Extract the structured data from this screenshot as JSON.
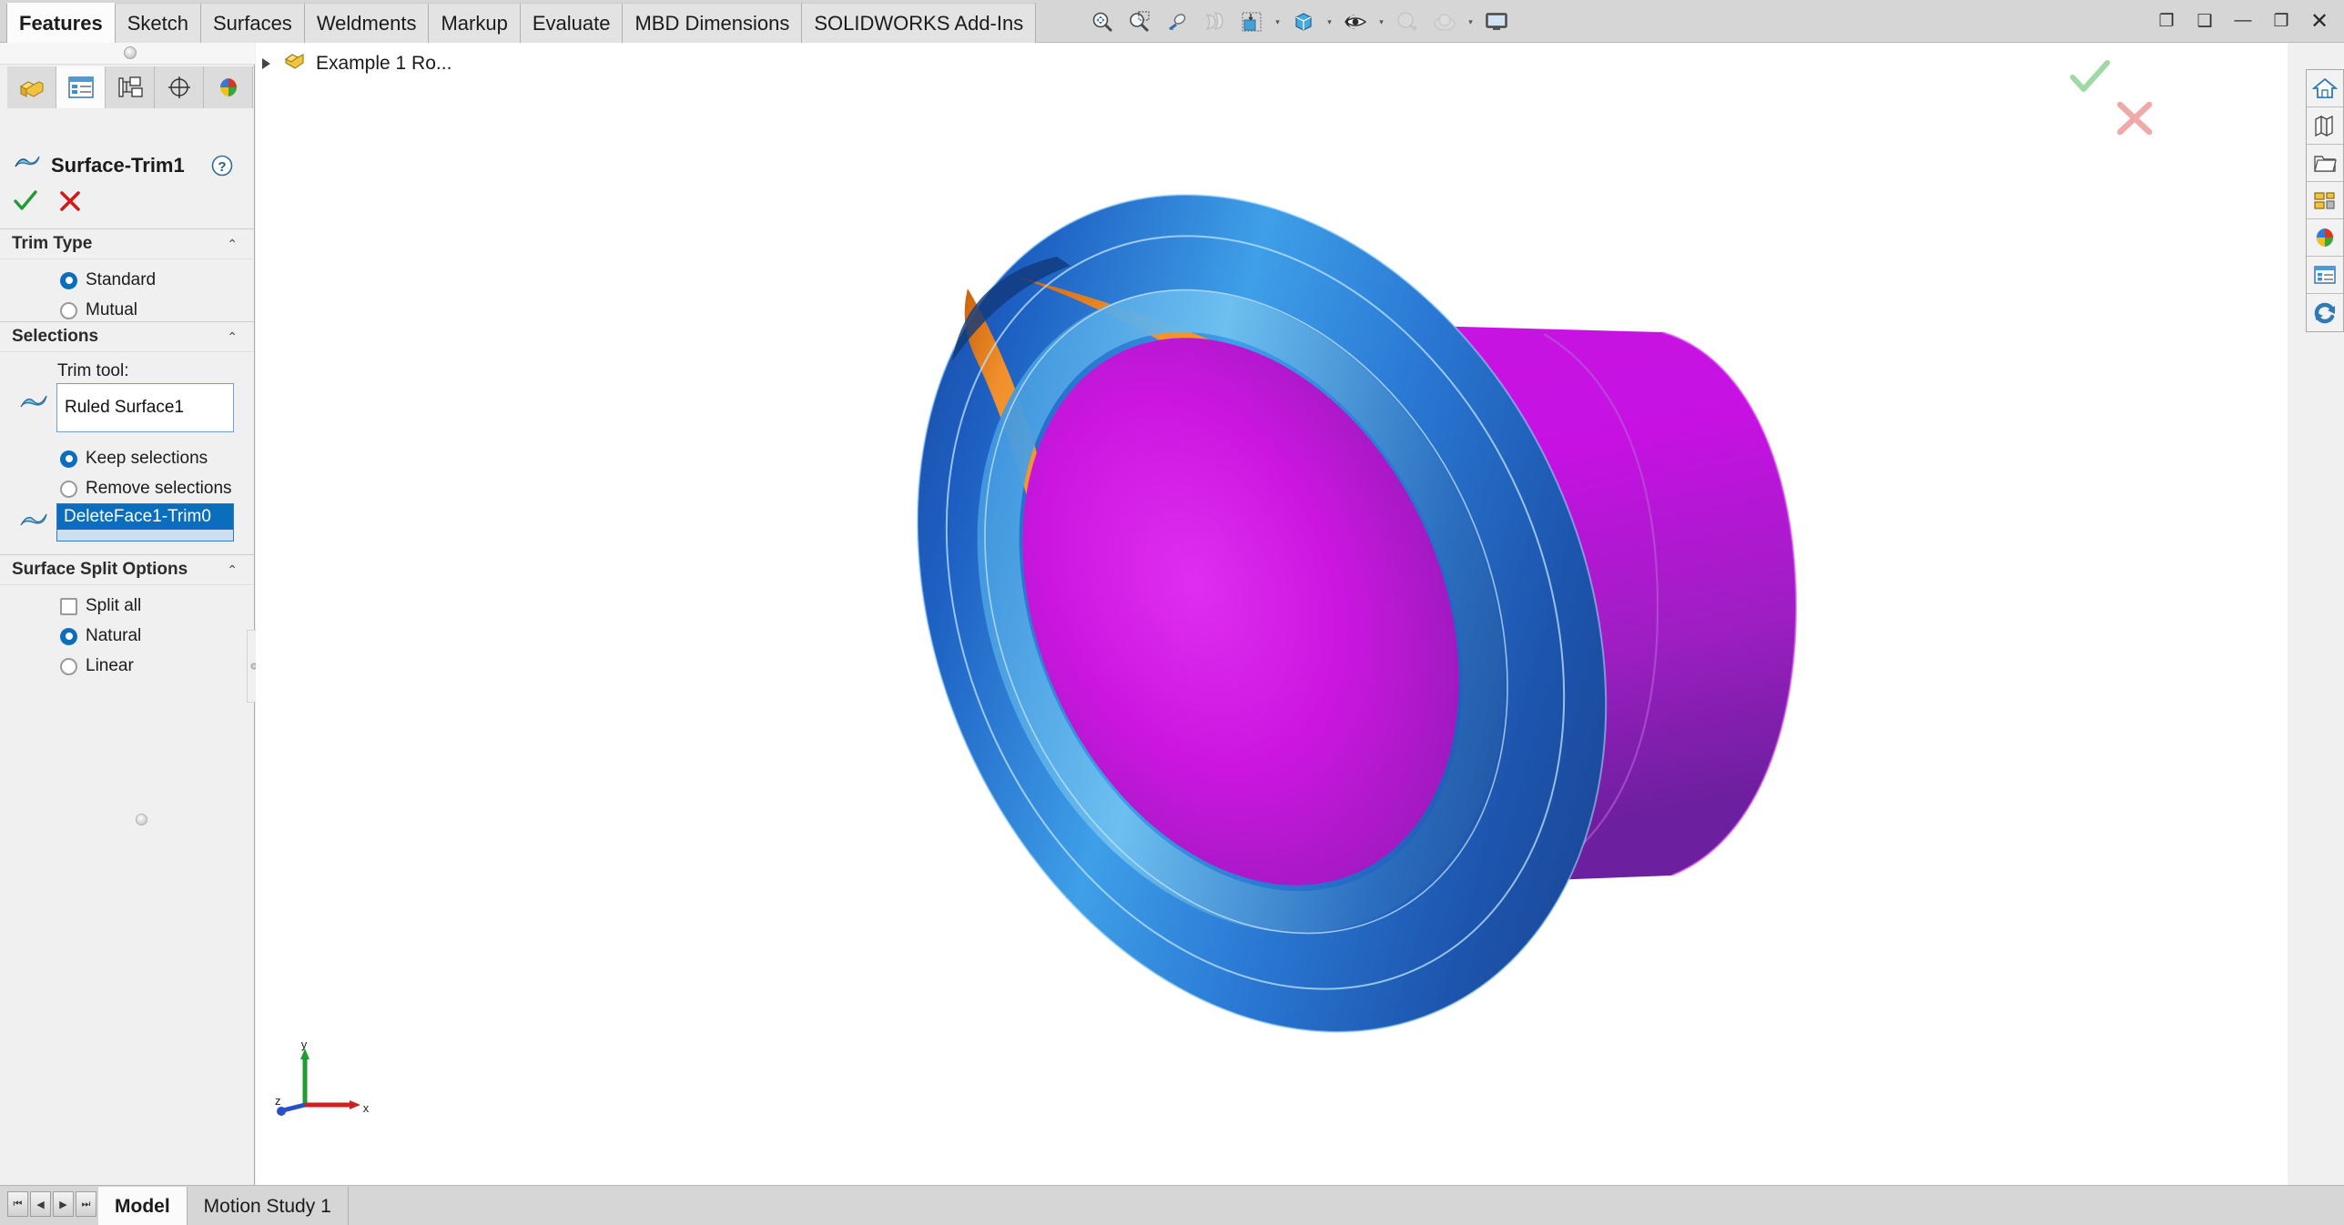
{
  "ribbon": {
    "tabs": [
      {
        "label": "Features",
        "active": true
      },
      {
        "label": "Sketch",
        "active": false
      },
      {
        "label": "Surfaces",
        "active": false
      },
      {
        "label": "Weldments",
        "active": false
      },
      {
        "label": "Markup",
        "active": false
      },
      {
        "label": "Evaluate",
        "active": false
      },
      {
        "label": "MBD Dimensions",
        "active": false
      },
      {
        "label": "SOLIDWORKS Add-Ins",
        "active": false
      }
    ],
    "view_toolbar": [
      {
        "name": "zoom-to-fit-icon",
        "caret": false
      },
      {
        "name": "zoom-to-area-icon",
        "caret": false
      },
      {
        "name": "previous-view-icon",
        "caret": false
      },
      {
        "name": "section-view-icon",
        "caret": false
      },
      {
        "name": "view-orientation-icon",
        "caret": true
      },
      {
        "name": "display-style-icon",
        "caret": true
      },
      {
        "name": "hide-show-items-icon",
        "caret": true
      },
      {
        "name": "edit-appearance-icon",
        "caret": true
      },
      {
        "name": "apply-scene-icon",
        "caret": true
      },
      {
        "name": "view-settings-icon",
        "caret": false
      }
    ],
    "window_controls": [
      {
        "name": "restore-panel-icon",
        "glyph": "❐"
      },
      {
        "name": "maximize-panel-icon",
        "glyph": "❑"
      },
      {
        "name": "minimize-window-button",
        "glyph": "—"
      },
      {
        "name": "restore-window-button",
        "glyph": "❐"
      },
      {
        "name": "close-window-button",
        "glyph": "✕"
      }
    ]
  },
  "property_manager": {
    "panel_tabs": [
      {
        "name": "feature-manager-tab",
        "icon": "yellow-part-icon",
        "active": false
      },
      {
        "name": "property-manager-tab",
        "icon": "property-list-icon",
        "active": true
      },
      {
        "name": "configuration-manager-tab",
        "icon": "configuration-tree-icon",
        "active": false
      },
      {
        "name": "dimxpert-manager-tab",
        "icon": "dimxpert-target-icon",
        "active": false
      },
      {
        "name": "display-manager-tab",
        "icon": "appearance-sphere-icon",
        "active": false
      }
    ],
    "header": {
      "icon": "surface-trim-icon",
      "title": "Surface-Trim1",
      "help_icon": "help-question-icon"
    },
    "ok_cancel": {
      "ok_name": "accept-checkmark-button",
      "cancel_name": "cancel-x-button"
    },
    "trim_type": {
      "title": "Trim Type",
      "options": [
        {
          "label": "Standard",
          "selected": true
        },
        {
          "label": "Mutual",
          "selected": false
        }
      ]
    },
    "selections": {
      "title": "Selections",
      "trim_tool_label": "Trim tool:",
      "trim_tool_value": "Ruled Surface1",
      "trim_tool_placeholder": "",
      "keep_remove": [
        {
          "label": "Keep selections",
          "selected": true
        },
        {
          "label": "Remove selections",
          "selected": false
        }
      ],
      "faces_value": "DeleteFace1-Trim0"
    },
    "surface_split_options": {
      "title": "Surface Split Options",
      "split_all": {
        "label": "Split all",
        "checked": false
      },
      "options": [
        {
          "label": "Natural",
          "selected": true
        },
        {
          "label": "Linear",
          "selected": false
        }
      ]
    }
  },
  "graphics": {
    "breadcrumb": "Example 1 Ro...",
    "breadcrumb_icon": "part-document-icon",
    "confirm_ok": "confirm-accept-checkmark",
    "confirm_cancel": "confirm-cancel-x",
    "triad": {
      "x": "x",
      "y": "y",
      "z": "z"
    }
  },
  "task_pane": [
    {
      "name": "solidworks-resources-icon",
      "glyph": "home"
    },
    {
      "name": "design-library-icon",
      "glyph": "library"
    },
    {
      "name": "file-explorer-icon",
      "glyph": "folder"
    },
    {
      "name": "view-palette-icon",
      "glyph": "palette"
    },
    {
      "name": "appearances-scenes-icon",
      "glyph": "sphere"
    },
    {
      "name": "custom-properties-icon",
      "glyph": "properties"
    },
    {
      "name": "solidworks-forum-icon",
      "glyph": "refresh"
    }
  ],
  "bottom": {
    "nav_buttons": [
      {
        "name": "first-tab-button",
        "glyph": "⏮"
      },
      {
        "name": "previous-tab-button",
        "glyph": "◀"
      },
      {
        "name": "next-tab-button",
        "glyph": "▶"
      },
      {
        "name": "last-tab-button",
        "glyph": "⏭"
      }
    ],
    "doc_tabs": [
      {
        "label": "Model",
        "active": true
      },
      {
        "label": "Motion Study 1",
        "active": false
      }
    ]
  },
  "colors": {
    "accent_blue": "#0a6ebd",
    "model_magenta": "#c018d8",
    "model_blue": "#1f63b8",
    "model_orange": "#f0892a",
    "ribbon_bg": "#d6d6d6",
    "panel_bg": "#f0f0f0"
  }
}
